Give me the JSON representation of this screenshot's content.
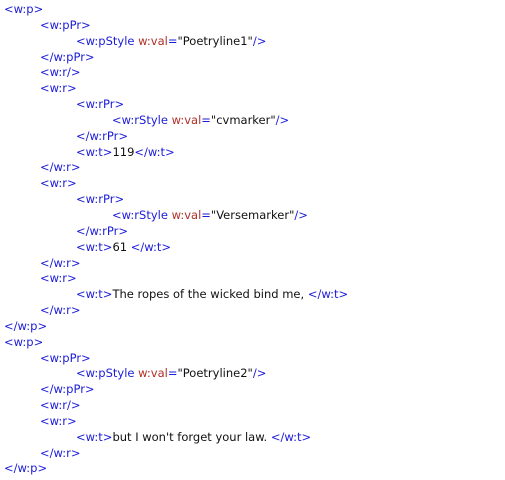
{
  "colors": {
    "tag": "#1b1bd8",
    "attr": "#b0302a",
    "value": "#111111",
    "text": "#111111"
  },
  "lines": [
    {
      "indent": 0,
      "parts": [
        {
          "c": "tag",
          "t": "<w:p>"
        }
      ]
    },
    {
      "indent": 1,
      "parts": [
        {
          "c": "tag",
          "t": "<w:pPr>"
        }
      ]
    },
    {
      "indent": 2,
      "parts": [
        {
          "c": "tag",
          "t": "<w:pStyle "
        },
        {
          "c": "attr",
          "t": "w:val"
        },
        {
          "c": "tag",
          "t": "="
        },
        {
          "c": "val",
          "t": "\"Poetryline1\""
        },
        {
          "c": "tag",
          "t": "/>"
        }
      ]
    },
    {
      "indent": 1,
      "parts": [
        {
          "c": "tag",
          "t": "</w:pPr>"
        }
      ]
    },
    {
      "indent": 1,
      "parts": [
        {
          "c": "tag",
          "t": "<w:r/>"
        }
      ]
    },
    {
      "indent": 1,
      "parts": [
        {
          "c": "tag",
          "t": "<w:r>"
        }
      ]
    },
    {
      "indent": 2,
      "parts": [
        {
          "c": "tag",
          "t": "<w:rPr>"
        }
      ]
    },
    {
      "indent": 3,
      "parts": [
        {
          "c": "tag",
          "t": "<w:rStyle "
        },
        {
          "c": "attr",
          "t": "w:val"
        },
        {
          "c": "tag",
          "t": "="
        },
        {
          "c": "val",
          "t": "\"cvmarker\""
        },
        {
          "c": "tag",
          "t": "/>"
        }
      ]
    },
    {
      "indent": 2,
      "parts": [
        {
          "c": "tag",
          "t": "</w:rPr>"
        }
      ]
    },
    {
      "indent": 2,
      "parts": [
        {
          "c": "tag",
          "t": "<w:t>"
        },
        {
          "c": "text",
          "t": "119"
        },
        {
          "c": "tag",
          "t": "</w:t>"
        }
      ]
    },
    {
      "indent": 1,
      "parts": [
        {
          "c": "tag",
          "t": "</w:r>"
        }
      ]
    },
    {
      "indent": 1,
      "parts": [
        {
          "c": "tag",
          "t": "<w:r>"
        }
      ]
    },
    {
      "indent": 2,
      "parts": [
        {
          "c": "tag",
          "t": "<w:rPr>"
        }
      ]
    },
    {
      "indent": 3,
      "parts": [
        {
          "c": "tag",
          "t": "<w:rStyle "
        },
        {
          "c": "attr",
          "t": "w:val"
        },
        {
          "c": "tag",
          "t": "="
        },
        {
          "c": "val",
          "t": "\"Versemarker\""
        },
        {
          "c": "tag",
          "t": "/>"
        }
      ]
    },
    {
      "indent": 2,
      "parts": [
        {
          "c": "tag",
          "t": "</w:rPr>"
        }
      ]
    },
    {
      "indent": 2,
      "parts": [
        {
          "c": "tag",
          "t": "<w:t>"
        },
        {
          "c": "text",
          "t": "61 "
        },
        {
          "c": "tag",
          "t": "</w:t>"
        }
      ]
    },
    {
      "indent": 1,
      "parts": [
        {
          "c": "tag",
          "t": "</w:r>"
        }
      ]
    },
    {
      "indent": 1,
      "parts": [
        {
          "c": "tag",
          "t": "<w:r>"
        }
      ]
    },
    {
      "indent": 2,
      "parts": [
        {
          "c": "tag",
          "t": "<w:t>"
        },
        {
          "c": "text",
          "t": "The ropes of the wicked bind me, "
        },
        {
          "c": "tag",
          "t": "</w:t>"
        }
      ]
    },
    {
      "indent": 1,
      "parts": [
        {
          "c": "tag",
          "t": "</w:r>"
        }
      ]
    },
    {
      "indent": 0,
      "parts": [
        {
          "c": "tag",
          "t": "</w:p>"
        }
      ]
    },
    {
      "indent": 0,
      "parts": [
        {
          "c": "tag",
          "t": "<w:p>"
        }
      ]
    },
    {
      "indent": 1,
      "parts": [
        {
          "c": "tag",
          "t": "<w:pPr>"
        }
      ]
    },
    {
      "indent": 2,
      "parts": [
        {
          "c": "tag",
          "t": "<w:pStyle "
        },
        {
          "c": "attr",
          "t": "w:val"
        },
        {
          "c": "tag",
          "t": "="
        },
        {
          "c": "val",
          "t": "\"Poetryline2\""
        },
        {
          "c": "tag",
          "t": "/>"
        }
      ]
    },
    {
      "indent": 1,
      "parts": [
        {
          "c": "tag",
          "t": "</w:pPr>"
        }
      ]
    },
    {
      "indent": 1,
      "parts": [
        {
          "c": "tag",
          "t": "<w:r/>"
        }
      ]
    },
    {
      "indent": 1,
      "parts": [
        {
          "c": "tag",
          "t": "<w:r>"
        }
      ]
    },
    {
      "indent": 2,
      "parts": [
        {
          "c": "tag",
          "t": "<w:t>"
        },
        {
          "c": "text",
          "t": "but I won't forget your law. "
        },
        {
          "c": "tag",
          "t": "</w:t>"
        }
      ]
    },
    {
      "indent": 1,
      "parts": [
        {
          "c": "tag",
          "t": "</w:r>"
        }
      ]
    },
    {
      "indent": 0,
      "parts": [
        {
          "c": "tag",
          "t": "</w:p>"
        }
      ]
    }
  ]
}
